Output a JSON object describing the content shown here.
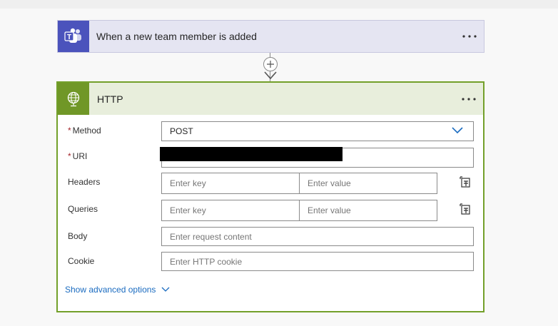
{
  "trigger": {
    "title": "When a new team member is added",
    "icon": "teams-icon",
    "accent": "#4b53bc"
  },
  "connector": {
    "icon": "add-step-icon"
  },
  "action": {
    "title": "HTTP",
    "icon": "globe-icon",
    "accent": "#709727",
    "fields": {
      "method": {
        "label": "Method",
        "required": true,
        "value": "POST"
      },
      "uri": {
        "label": "URI",
        "required": true
      },
      "headers": {
        "label": "Headers",
        "key_placeholder": "Enter key",
        "value_placeholder": "Enter value"
      },
      "queries": {
        "label": "Queries",
        "key_placeholder": "Enter key",
        "value_placeholder": "Enter value"
      },
      "body": {
        "label": "Body",
        "placeholder": "Enter request content"
      },
      "cookie": {
        "label": "Cookie",
        "placeholder": "Enter HTTP cookie"
      }
    },
    "advanced_link": "Show advanced options"
  },
  "colors": {
    "link": "#1a6bc0",
    "required": "#a4262c",
    "border_active": "#73a02a"
  }
}
